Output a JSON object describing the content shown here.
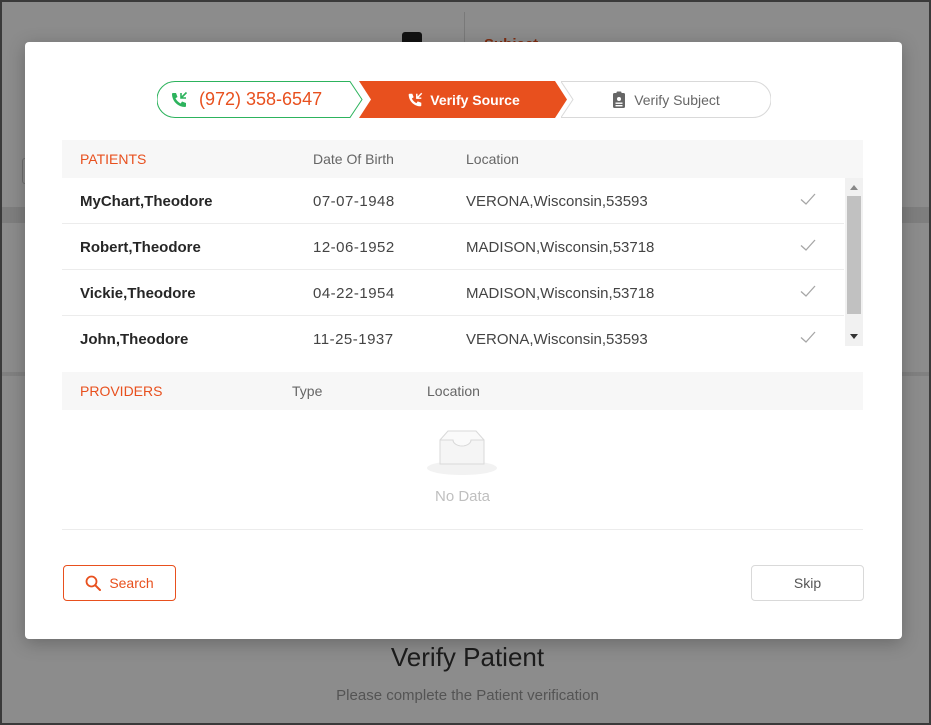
{
  "background": {
    "subject_label": "Subject",
    "title": "Verify Patient",
    "subtitle": "Please complete the Patient verification"
  },
  "stepper": {
    "phone": "(972) 358-6547",
    "step2_label": "Verify Source",
    "step3_label": "Verify Subject"
  },
  "patients": {
    "headers": [
      "PATIENTS",
      "Date Of Birth",
      "Location"
    ],
    "rows": [
      {
        "name": "MyChart,Theodore",
        "dob": "07-07-1948",
        "location": "VERONA,Wisconsin,53593"
      },
      {
        "name": "Robert,Theodore",
        "dob": "12-06-1952",
        "location": "MADISON,Wisconsin,53718"
      },
      {
        "name": "Vickie,Theodore",
        "dob": "04-22-1954",
        "location": "MADISON,Wisconsin,53718"
      },
      {
        "name": "John,Theodore",
        "dob": "11-25-1937",
        "location": "VERONA,Wisconsin,53593"
      }
    ]
  },
  "providers": {
    "headers": [
      "PROVIDERS",
      "Type",
      "Location"
    ],
    "empty_text": "No Data"
  },
  "buttons": {
    "search": "Search",
    "skip": "Skip"
  },
  "colors": {
    "accent": "#e8501e",
    "success": "#2db35d"
  }
}
